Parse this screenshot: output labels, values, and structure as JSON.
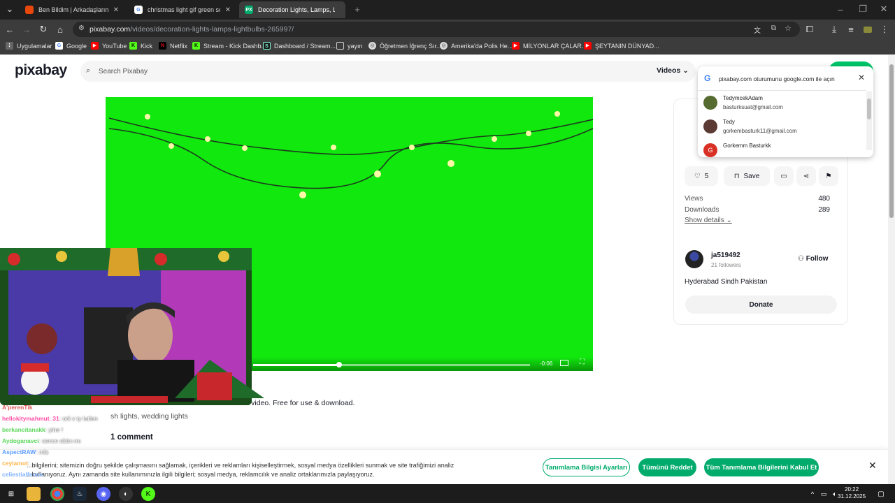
{
  "browser": {
    "tabs": [
      {
        "title": "Ben Bildim | Arkadaşlarınla Onli...",
        "active": false,
        "icon_color": "#e8470c"
      },
      {
        "title": "christmas light gif green screen",
        "active": false,
        "icon_color": "#4285f4"
      },
      {
        "title": "Decoration Lights, Lamps, Light...",
        "active": true,
        "icon_color": "#00ab6c"
      }
    ],
    "new_tab_symbol": "+",
    "url_host": "pixabay.com",
    "url_path": "/videos/decoration-lights-lamps-lightbulbs-265997/",
    "bookmarks": [
      {
        "label": "Uygulamalar",
        "icon": "apps-grid-icon",
        "color": "#e8e8e8"
      },
      {
        "label": "Google",
        "icon": "google-icon",
        "color": "#4285f4"
      },
      {
        "label": "YouTube",
        "icon": "youtube-icon",
        "color": "#ff0000"
      },
      {
        "label": "Kick",
        "icon": "kick-icon",
        "color": "#53fc18"
      },
      {
        "label": "Netflix",
        "icon": "netflix-icon",
        "color": "#e50914"
      },
      {
        "label": "Stream - Kick Dashb...",
        "icon": "kick-icon",
        "color": "#53fc18"
      },
      {
        "label": "Dashboard / Stream...",
        "icon": "streamlabs-icon",
        "color": "#80f5d2"
      },
      {
        "label": "yayın",
        "icon": "folder-icon",
        "color": "#cccccc"
      },
      {
        "label": "Öğretmen İğrenç Sır...",
        "icon": "globe-icon",
        "color": "#cccccc"
      },
      {
        "label": "Amerika'da Polis He...",
        "icon": "globe-icon",
        "color": "#cccccc"
      },
      {
        "label": "MİLYONLAR ÇALAR...",
        "icon": "youtube-icon",
        "color": "#ff0000"
      },
      {
        "label": "ŞEYTANIN DÜNYAD...",
        "icon": "youtube-icon",
        "color": "#ff0000"
      }
    ]
  },
  "site": {
    "logo": "pixabay",
    "search_placeholder": "Search Pixabay",
    "media_type": "Videos"
  },
  "video": {
    "time_remaining": "-0:06",
    "progress_fraction": 0.31
  },
  "google_popup": {
    "title": "pixabay.com oturumunu google.com ile açın",
    "accounts": [
      {
        "name": "TedymcekAdam",
        "email": "basturksuat@gmail.com",
        "avatar_color": "#556b2f"
      },
      {
        "name": "Tedy",
        "email": "gorkembasturk11@gmail.com",
        "avatar_color": "#5a3a32"
      },
      {
        "name": "Gorkemm Basturkk",
        "email": "",
        "avatar_color": "#d93025",
        "initial": "G"
      }
    ]
  },
  "details": {
    "likes": "5",
    "save_label": "Save",
    "views_label": "Views",
    "views": "480",
    "downloads_label": "Downloads",
    "downloads": "289",
    "show_details": "Show details",
    "user_name": "ja519492",
    "user_followers": "21 followers",
    "follow_label": "Follow",
    "location": "Hyderabad Sindh Pakistan",
    "donate_label": "Donate"
  },
  "description": {
    "text_visible": "tock video. Free for use & download.",
    "tags_visible": "sh lights, wedding lights",
    "comments": "1 comment"
  },
  "cookie": {
    "line1": "...bilgilerini; sitemizin doğru şekilde çalışmasını sağlamak, içerikleri ve reklamları kişiselleştirmek, sosyal medya özellikleri sunmak ve site trafiğimizi analiz",
    "line2": "...kullanıyoruz. Aynı zamanda site kullanımınızla ilgili bilgileri; sosyal medya, reklamcılık ve analiz ortaklarımızla paylaşıyoruz.",
    "settings_btn": "Tanımlama Bilgisi Ayarları",
    "reject_btn": "Tümünü Reddet",
    "accept_btn": "Tüm Tanımlama Bilgilerini Kabul Et",
    "accent": "#00ab6c"
  },
  "stream_chat": [
    {
      "user": "A'perenTik",
      "msg": "",
      "color": "#e05b5b"
    },
    {
      "user": "hellokitymahmut_31",
      "msg": ": orli x ty lutfen",
      "color": "#ff4fa3"
    },
    {
      "user": "berkancitanakk",
      "msg": ": yine !",
      "color": "#5bd65b"
    },
    {
      "user": "Aydoganavci",
      "msg": ": sence aldın mı",
      "color": "#5bd65b"
    },
    {
      "user": "AspectRAW",
      "msg": ": nıls",
      "color": "#5b9bff"
    },
    {
      "user": "ceyiamot",
      "msg": ": ...",
      "color": "#ffb347"
    },
    {
      "user": "celiestialfenox",
      "msg": "",
      "color": "#7fb0ff"
    }
  ],
  "taskbar": {
    "time": "20:22",
    "date": "31.12.2025"
  }
}
